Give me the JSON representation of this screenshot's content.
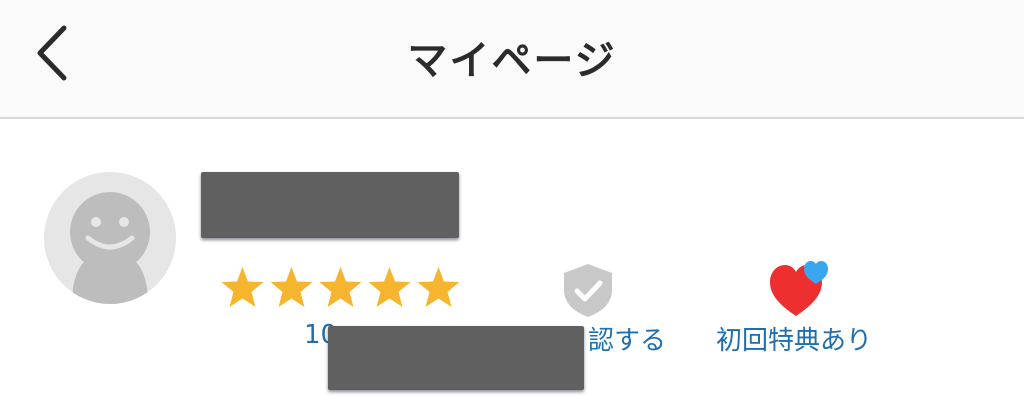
{
  "header": {
    "title": "マイページ"
  },
  "profile": {
    "rating_stars": 5,
    "review_count_visible": "10",
    "verify_label_visible": "認する",
    "benefit_label": "初回特典あり"
  },
  "colors": {
    "star": "#f5b52e",
    "link": "#1f6fae",
    "heart": "#ee2f2f",
    "heart_small": "#3aa6ef",
    "shield": "#c8c8c8"
  },
  "icons": {
    "back": "chevron-left-icon",
    "avatar": "user-avatar-icon",
    "verify": "shield-check-icon",
    "benefit": "heart-icon"
  }
}
